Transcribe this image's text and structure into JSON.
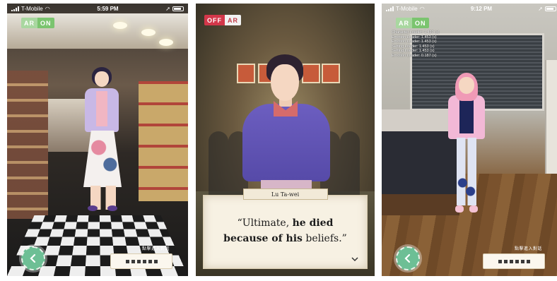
{
  "panels": [
    {
      "status": {
        "carrier": "T-Mobile",
        "time": "5:59 PM"
      },
      "ar_toggle": {
        "ar": "AR",
        "state": "ON"
      },
      "debug_lines": [],
      "tap_hint": "點擊進入對話"
    },
    {
      "status": {
        "carrier": "",
        "time": ""
      },
      "ar_toggle": {
        "ar": "AR",
        "state": "OFF"
      },
      "dialog": {
        "speaker": "Lu Ta-wei",
        "text_prefix": "“Ultimate, ",
        "text_bold": "he died because of his",
        "text_suffix": " beliefs.”"
      }
    },
    {
      "status": {
        "carrier": "T-Mobile",
        "time": "9:12 PM"
      },
      "ar_toggle": {
        "ar": "AR",
        "state": "ON"
      },
      "debug_lines": [
        "Character Loader: 1.420 (s)",
        "Emotion Loader: 1.453 (s)",
        "Emotion Loader: 1.453 (s)",
        "Setting Loader: 1.453 (s)",
        "Setting Loader: 1.453 (s)",
        "Emotion Loader: 0.187 (s)"
      ],
      "tap_hint": "點擊進入對話"
    }
  ],
  "icons": {
    "back": "back-arrow-icon",
    "next": "chevron-down-icon"
  },
  "colors": {
    "ar_on": "#7bc46f",
    "ar_off": "#d3374a",
    "back_button": "#6dbf95"
  }
}
